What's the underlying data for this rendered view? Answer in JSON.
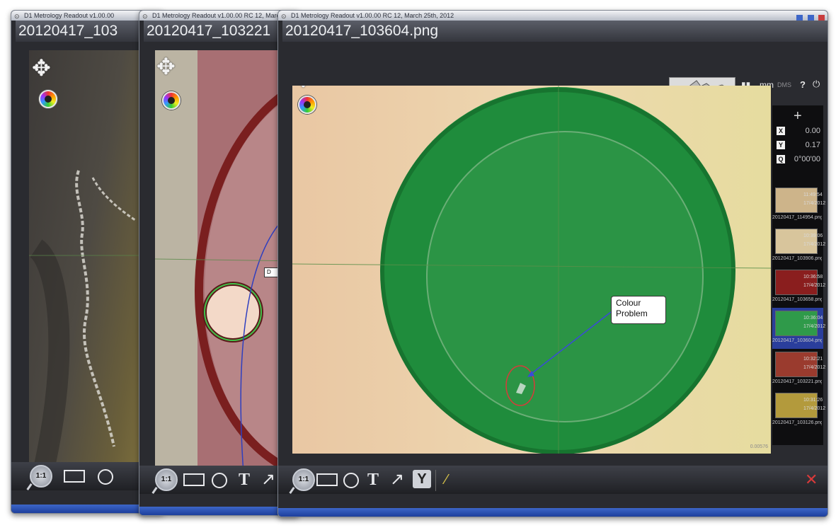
{
  "windows": [
    {
      "id": "back",
      "title_bar": "D1 Metrology Readout  v1.00.00",
      "filename": "20120417_103"
    },
    {
      "id": "middle",
      "title_bar": "D1 Metrology Readout  v1.00.00 RC 12, March",
      "filename": "20120417_103221",
      "label_box": "D"
    },
    {
      "id": "front",
      "title_bar": "D1 Metrology Readout  v1.00.00 RC 12, March 25th, 2012",
      "filename": "20120417_103604.png",
      "annotation": {
        "line1": "Colour",
        "line2": "Problem"
      },
      "scale_text": "0.00576",
      "units": "mm",
      "dms": "DMS",
      "help": "?",
      "readout": [
        {
          "key": "X",
          "value": "0.00"
        },
        {
          "key": "Y",
          "value": "0.17"
        },
        {
          "key": "Q",
          "value": "0°00'00"
        }
      ],
      "thumbnails": [
        {
          "time": "11:49:54",
          "date": "17/4/2012",
          "name": "20120417_114954.png",
          "color": "#cdb48a",
          "selected": false
        },
        {
          "time": "10:39:06",
          "date": "17/4/2012",
          "name": "20120417_103906.png",
          "color": "#d8c59c",
          "selected": false
        },
        {
          "time": "10:36:58",
          "date": "17/4/2012",
          "name": "20120417_103658.png",
          "color": "#8a1e1e",
          "selected": false
        },
        {
          "time": "10:36:04",
          "date": "17/4/2012",
          "name": "20120417_103604.png",
          "color": "#2f9a4a",
          "selected": true
        },
        {
          "time": "10:32:21",
          "date": "17/4/2012",
          "name": "20120417_103221.png",
          "color": "#9a3b2e",
          "selected": false
        },
        {
          "time": "10:31:26",
          "date": "17/4/2012",
          "name": "20120417_103126.png",
          "color": "#b39a3c",
          "selected": false
        }
      ]
    }
  ],
  "toolbar": {
    "zoom_label": "1:1",
    "text_tool": "T"
  }
}
